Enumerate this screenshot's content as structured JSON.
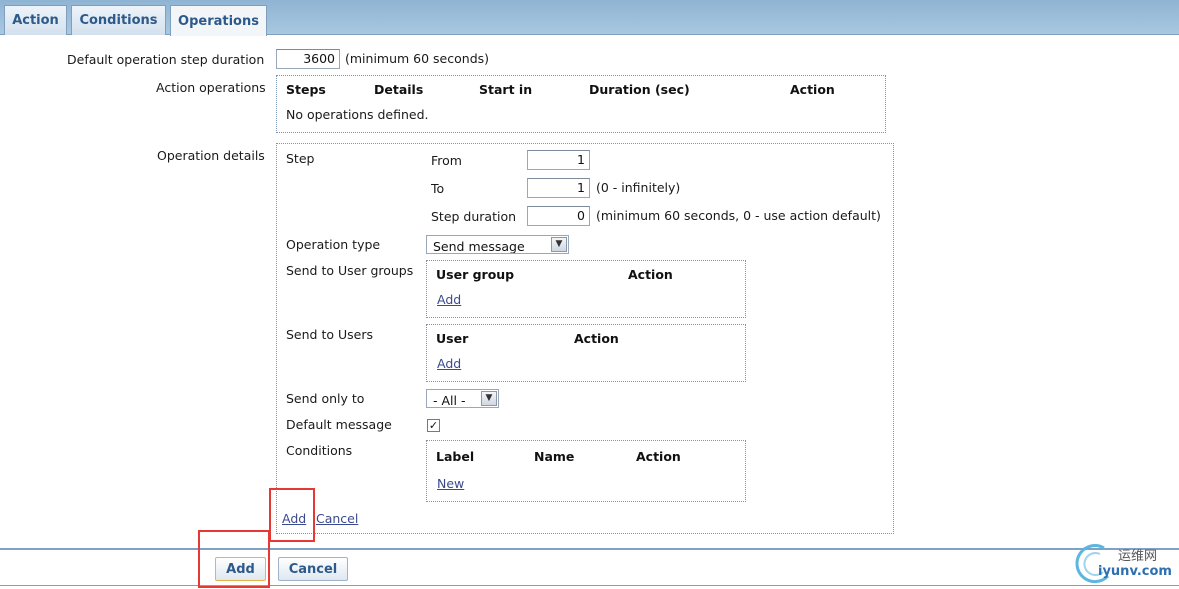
{
  "tabs": [
    "Action",
    "Conditions",
    "Operations"
  ],
  "default_duration": {
    "label": "Default operation step duration",
    "value": "3600",
    "hint": "(minimum 60 seconds)"
  },
  "action_operations": {
    "label": "Action operations",
    "columns": [
      "Steps",
      "Details",
      "Start in",
      "Duration (sec)",
      "Action"
    ],
    "empty_text": "No operations defined."
  },
  "operation_details": {
    "label": "Operation details",
    "step_label": "Step",
    "from_label": "From",
    "from_value": "1",
    "to_label": "To",
    "to_value": "1",
    "to_hint": "(0 - infinitely)",
    "step_duration_label": "Step duration",
    "step_duration_value": "0",
    "step_duration_hint": "(minimum 60 seconds, 0 - use action default)",
    "operation_type_label": "Operation type",
    "operation_type_value": "Send message",
    "user_groups_label": "Send to User groups",
    "user_groups_columns": [
      "User group",
      "Action"
    ],
    "user_groups_add": "Add",
    "users_label": "Send to Users",
    "users_columns": [
      "User",
      "Action"
    ],
    "users_add": "Add",
    "send_only_to_label": "Send only to",
    "send_only_to_value": "- All -",
    "default_message_label": "Default message",
    "default_message_checked": true,
    "conditions_label": "Conditions",
    "conditions_columns": [
      "Label",
      "Name",
      "Action"
    ],
    "conditions_new": "New",
    "add_link": "Add",
    "cancel_link": "Cancel"
  },
  "footer": {
    "add_button": "Add",
    "cancel_button": "Cancel"
  },
  "watermark": {
    "chinese": "运维网",
    "domain": "iyunv.com"
  },
  "colors": {
    "tab_text": "#2d5a8a",
    "link": "#3b4a8c",
    "highlight": "#e53935"
  }
}
